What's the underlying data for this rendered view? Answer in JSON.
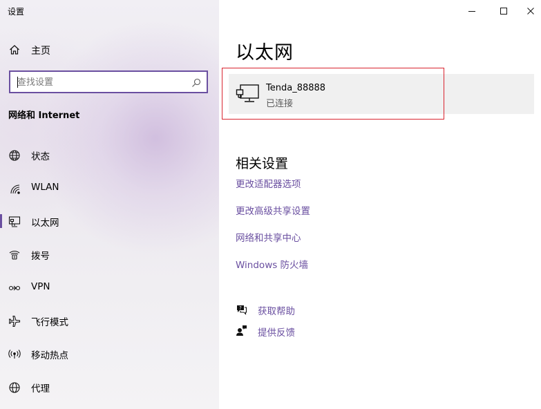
{
  "window": {
    "title": "设置",
    "controls": {
      "minimize": "minimize-icon",
      "maximize": "maximize-icon",
      "close": "close-icon"
    }
  },
  "sidebar": {
    "home_label": "主页",
    "search_placeholder": "查找设置",
    "section_heading": "网络和 Internet",
    "items": [
      {
        "label": "状态",
        "icon": "globe-status-icon"
      },
      {
        "label": "WLAN",
        "icon": "wifi-icon"
      },
      {
        "label": "以太网",
        "icon": "ethernet-icon",
        "active": true
      },
      {
        "label": "拨号",
        "icon": "dialup-icon"
      },
      {
        "label": "VPN",
        "icon": "vpn-icon"
      },
      {
        "label": "飞行模式",
        "icon": "airplane-icon"
      },
      {
        "label": "移动热点",
        "icon": "hotspot-icon"
      },
      {
        "label": "代理",
        "icon": "globe-proxy-icon"
      }
    ]
  },
  "main": {
    "title": "以太网",
    "network": {
      "name": "Tenda_88888",
      "status": "已连接",
      "icon": "ethernet-computer-icon"
    },
    "related": {
      "title": "相关设置",
      "links": [
        "更改适配器选项",
        "更改高级共享设置",
        "网络和共享中心",
        "Windows 防火墙"
      ]
    },
    "help": [
      {
        "label": "获取帮助",
        "icon": "help-chat-icon"
      },
      {
        "label": "提供反馈",
        "icon": "feedback-icon"
      }
    ]
  },
  "colors": {
    "accent": "#6a4fa0",
    "highlight_border": "#d9232e",
    "card_bg": "#f0f0f0"
  }
}
